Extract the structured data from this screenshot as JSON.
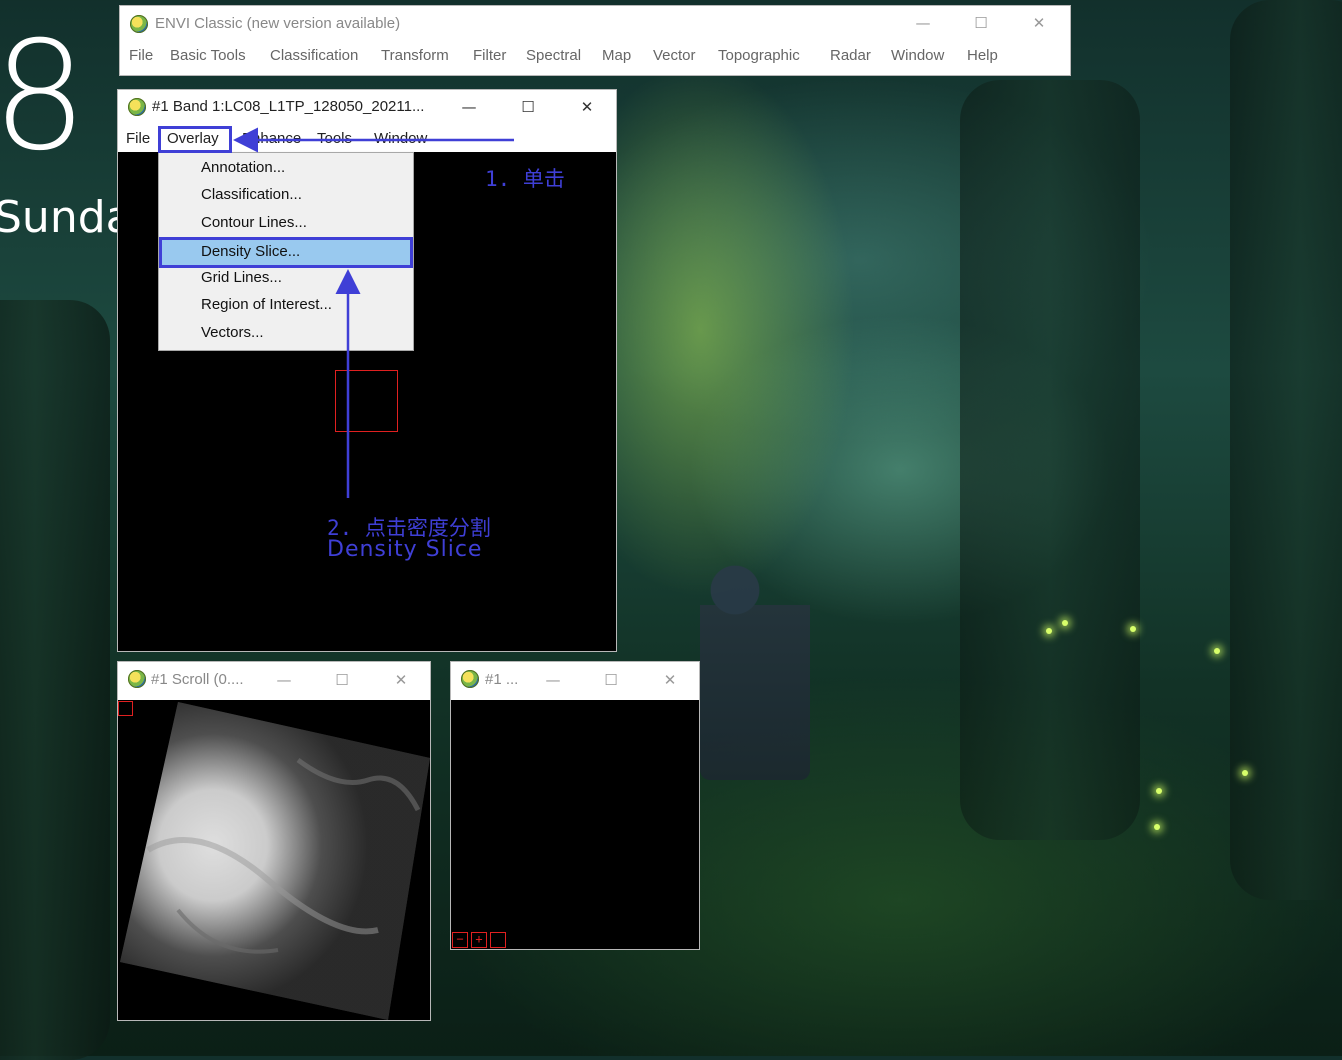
{
  "desktop": {
    "clock_digit": "8",
    "day": "Sunday"
  },
  "main_window": {
    "title": "ENVI Classic (new version available)",
    "menu": [
      "File",
      "Basic Tools",
      "Classification",
      "Transform",
      "Filter",
      "Spectral",
      "Map",
      "Vector",
      "Topographic",
      "Radar",
      "Window",
      "Help"
    ]
  },
  "image_window": {
    "title": "#1 Band 1:LC08_L1TP_128050_20211...",
    "menu": [
      "File",
      "Overlay",
      "Enhance",
      "Tools",
      "Window"
    ]
  },
  "overlay_menu": {
    "items": [
      "Annotation...",
      "Classification...",
      "Contour Lines...",
      "Density Slice...",
      "Grid Lines...",
      "Region of Interest...",
      "Vectors..."
    ],
    "selected": "Density Slice..."
  },
  "annotations": {
    "step1": "1. 单击",
    "step2_line1": "2. 点击密度分割",
    "step2_line2": "Density Slice",
    "color": "#3f3fd6"
  },
  "scroll_window": {
    "title": "#1 Scroll (0...."
  },
  "zoom_window": {
    "title": "#1 ...",
    "zoom_controls": [
      "−",
      "+",
      ""
    ]
  },
  "window_controls": {
    "minimize": "—",
    "maximize": "☐",
    "close": "✕"
  }
}
